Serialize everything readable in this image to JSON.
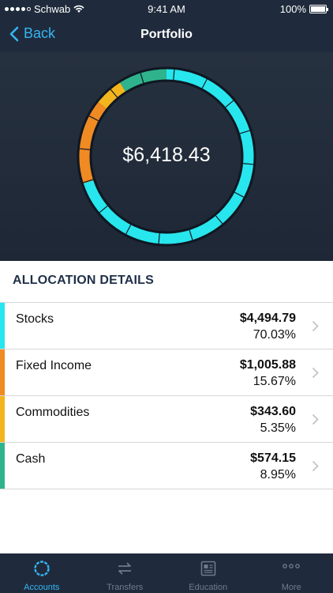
{
  "status_bar": {
    "carrier": "Schwab",
    "time": "9:41 AM",
    "battery": "100%"
  },
  "nav": {
    "back_label": "Back",
    "title": "Portfolio"
  },
  "portfolio": {
    "total": "$6,418.43"
  },
  "allocation": {
    "title": "ALLOCATION DETAILS",
    "items": [
      {
        "name": "Stocks",
        "amount": "$4,494.79",
        "percent": "70.03%",
        "share": 0.7003,
        "color": "#27e6ee"
      },
      {
        "name": "Fixed Income",
        "amount": "$1,005.88",
        "percent": "15.67%",
        "share": 0.1567,
        "color": "#f08a23"
      },
      {
        "name": "Commodities",
        "amount": "$343.60",
        "percent": "5.35%",
        "share": 0.0535,
        "color": "#f2b51d"
      },
      {
        "name": "Cash",
        "amount": "$574.15",
        "percent": "8.95%",
        "share": 0.0895,
        "color": "#2eb38d"
      }
    ]
  },
  "tabs": [
    {
      "label": "Accounts",
      "icon": "accounts-icon",
      "active": true
    },
    {
      "label": "Transfers",
      "icon": "transfers-icon",
      "active": false
    },
    {
      "label": "Education",
      "icon": "education-icon",
      "active": false
    },
    {
      "label": "More",
      "icon": "more-icon",
      "active": false
    }
  ],
  "colors": {
    "nav_bg": "#1f2b3c",
    "accent": "#35b5f2",
    "heading": "#1f3048"
  }
}
